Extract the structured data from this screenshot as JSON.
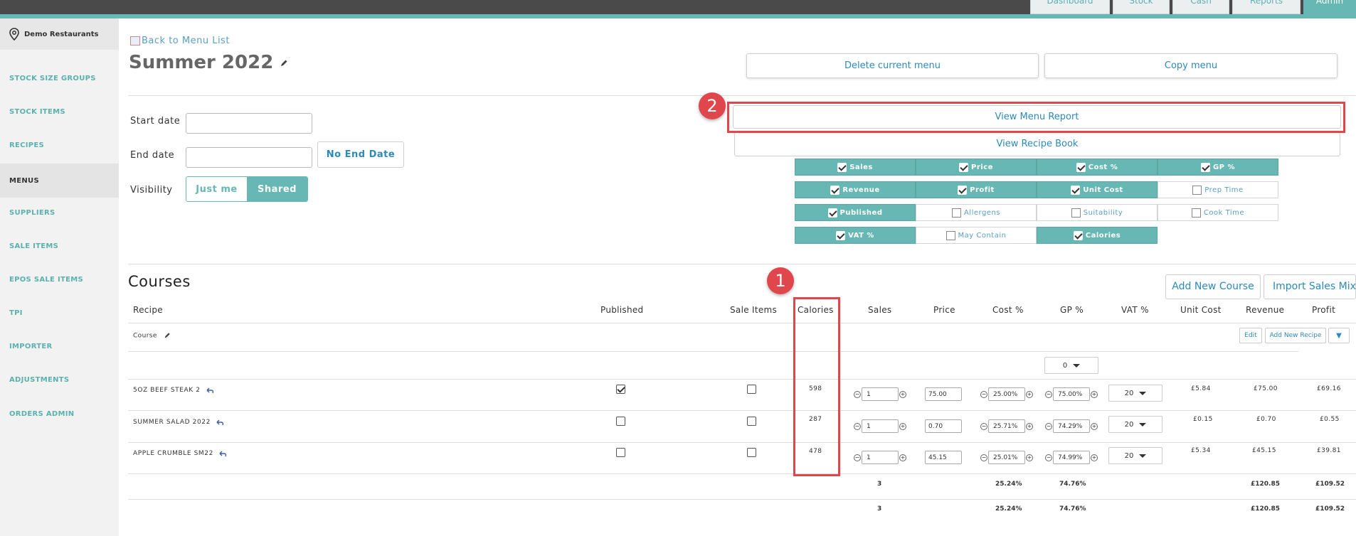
{
  "top_nav": {
    "tabs": [
      {
        "label": "Dashboard",
        "active": false
      },
      {
        "label": "Stock",
        "active": false
      },
      {
        "label": "Cash",
        "active": false
      },
      {
        "label": "Reports",
        "active": false
      },
      {
        "label": "Admin",
        "active": true
      }
    ]
  },
  "sidebar": {
    "location": "Demo Restaurants",
    "items": [
      {
        "label": "STOCK SIZE GROUPS",
        "active": false
      },
      {
        "label": "STOCK ITEMS",
        "active": false
      },
      {
        "label": "RECIPES",
        "active": false
      },
      {
        "label": "MENUS",
        "active": true
      },
      {
        "label": "SUPPLIERS",
        "active": false
      },
      {
        "label": "SALE ITEMS",
        "active": false
      },
      {
        "label": "EPOS SALE ITEMS",
        "active": false
      },
      {
        "label": "TPI",
        "active": false
      },
      {
        "label": "IMPORTER",
        "active": false
      },
      {
        "label": "ADJUSTMENTS",
        "active": false
      },
      {
        "label": "ORDERS ADMIN",
        "active": false
      }
    ]
  },
  "header": {
    "back_link": "Back to Menu List",
    "title": "Summer 2022",
    "delete_label": "Delete current menu",
    "copy_label": "Copy menu",
    "view_menu_report": "View Menu Report",
    "view_recipe_book": "View Recipe Book"
  },
  "form": {
    "start_date_label": "Start date",
    "start_date_value": "",
    "end_date_label": "End date",
    "end_date_value": "",
    "no_end_date": "No End Date",
    "visibility_label": "Visibility",
    "visibility_options": [
      "Just me",
      "Shared"
    ],
    "visibility_selected": "Shared"
  },
  "columns": [
    {
      "label": "Sales",
      "checked": true
    },
    {
      "label": "Price",
      "checked": true
    },
    {
      "label": "Cost %",
      "checked": true
    },
    {
      "label": "GP %",
      "checked": true
    },
    {
      "label": "Revenue",
      "checked": true
    },
    {
      "label": "Profit",
      "checked": true
    },
    {
      "label": "Unit Cost",
      "checked": true
    },
    {
      "label": "Prep Time",
      "checked": false
    },
    {
      "label": "Published",
      "checked": true
    },
    {
      "label": "Allergens",
      "checked": false
    },
    {
      "label": "Suitability",
      "checked": false
    },
    {
      "label": "Cook Time",
      "checked": false
    },
    {
      "label": "VAT %",
      "checked": true
    },
    {
      "label": "May Contain",
      "checked": false
    },
    {
      "label": "Calories",
      "checked": true
    }
  ],
  "annotations": {
    "badge1": "1",
    "badge2": "2"
  },
  "courses": {
    "title": "Courses",
    "add_new_course": "Add New Course",
    "import_sales_mix": "Import Sales Mix",
    "headers": [
      "Recipe",
      "Published",
      "Sale Items",
      "Calories",
      "Sales",
      "Price",
      "Cost %",
      "GP %",
      "VAT %",
      "Unit Cost",
      "Revenue",
      "Profit"
    ],
    "course_name": "Course",
    "edit_label": "Edit",
    "add_new_recipe": "Add New Recipe",
    "dropdown_caret": "▼",
    "course_gp_select": "0",
    "rows": [
      {
        "name": "5OZ BEEF STEAK 2",
        "published": true,
        "sale_items": false,
        "calories": "598",
        "sales": "1",
        "price": "75.00",
        "cost_pct": "25.00%",
        "gp_pct": "75.00%",
        "vat": "20",
        "unit_cost": "£5.84",
        "revenue": "£75.00",
        "profit": "£69.16"
      },
      {
        "name": "SUMMER SALAD 2022",
        "published": false,
        "sale_items": false,
        "calories": "287",
        "sales": "1",
        "price": "0.70",
        "cost_pct": "25.71%",
        "gp_pct": "74.29%",
        "vat": "20",
        "unit_cost": "£0.15",
        "revenue": "£0.70",
        "profit": "£0.55"
      },
      {
        "name": "APPLE CRUMBLE SM22",
        "published": false,
        "sale_items": false,
        "calories": "478",
        "sales": "1",
        "price": "45.15",
        "cost_pct": "25.01%",
        "gp_pct": "74.99%",
        "vat": "20",
        "unit_cost": "£5.34",
        "revenue": "£45.15",
        "profit": "£39.81"
      }
    ],
    "totals": [
      {
        "sales": "3",
        "cost_pct": "25.24%",
        "gp_pct": "74.76%",
        "revenue": "£120.85",
        "profit": "£109.52"
      },
      {
        "sales": "3",
        "cost_pct": "25.24%",
        "gp_pct": "74.76%",
        "revenue": "£120.85",
        "profit": "£109.52"
      }
    ]
  },
  "colors": {
    "accent": "#67b8b4",
    "link": "#2d8ab8",
    "highlight": "#e0474c"
  }
}
